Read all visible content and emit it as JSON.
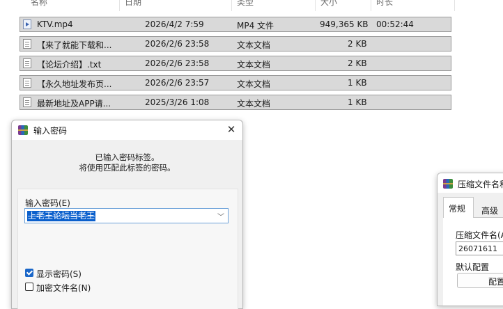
{
  "explorer": {
    "columns": [
      "名称",
      "日期",
      "类型",
      "大小",
      "时长"
    ],
    "files": [
      {
        "name": "KTV.mp4",
        "date": "2026/4/2 7:59",
        "type": "MP4 文件",
        "size": "949,365 KB",
        "duration": "00:52:44",
        "icon": "video-file-icon"
      },
      {
        "name": "【来了就能下载和...",
        "date": "2026/2/6 23:58",
        "type": "文本文档",
        "size": "2 KB",
        "duration": "",
        "icon": "text-file-icon"
      },
      {
        "name": "【论坛介绍】.txt",
        "date": "2026/2/6 23:58",
        "type": "文本文档",
        "size": "2 KB",
        "duration": "",
        "icon": "text-file-icon"
      },
      {
        "name": "【永久地址发布页...",
        "date": "2026/2/6 23:57",
        "type": "文本文档",
        "size": "1 KB",
        "duration": "",
        "icon": "text-file-icon"
      },
      {
        "name": "最新地址及APP请...",
        "date": "2025/3/26 1:08",
        "type": "文本文档",
        "size": "1 KB",
        "duration": "",
        "icon": "text-file-icon"
      }
    ]
  },
  "password_dialog": {
    "title": "输入密码",
    "message_line1": "已输入密码标签。",
    "message_line2": "将使用匹配此标签的密码。",
    "password_label": "输入密码(E)",
    "password_value": "上老王论坛当老王",
    "show_password_label": "显示密码(S)",
    "show_password_checked": true,
    "encrypt_names_label": "加密文件名(N)",
    "encrypt_names_checked": false
  },
  "archive_dialog": {
    "title": "压缩文件名和",
    "tabs": [
      "常规",
      "高级"
    ],
    "filename_label": "压缩文件名(A",
    "filename_value": "26071611",
    "default_config_label": "默认配置",
    "config_button": "配置"
  }
}
